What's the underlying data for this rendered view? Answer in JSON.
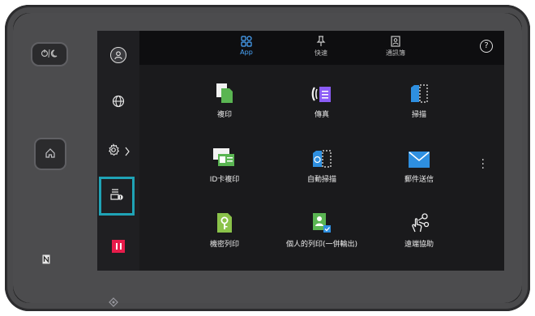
{
  "hardware": {
    "power_label": "ᴼᴵ/☾",
    "nfc_label": "N"
  },
  "tabs": [
    {
      "label": "App",
      "active": true
    },
    {
      "label": "快速",
      "active": false
    },
    {
      "label": "通訊簿",
      "active": false
    }
  ],
  "apps": [
    {
      "label": "複印"
    },
    {
      "label": "傳真"
    },
    {
      "label": "掃描"
    },
    {
      "label": "ID卡複印"
    },
    {
      "label": "自動掃描"
    },
    {
      "label": "郵件送信"
    },
    {
      "label": "機密列印"
    },
    {
      "label": "個人的列印(一併輸出)"
    },
    {
      "label": "遠端協助"
    }
  ],
  "help_label": "?",
  "colors": {
    "active_tab": "#4aa8ff",
    "highlight": "#1fa3b6",
    "stop_red": "#e81c4b",
    "green": "#5ab552",
    "purple": "#8b5cf6",
    "blue": "#2e8fe0"
  }
}
